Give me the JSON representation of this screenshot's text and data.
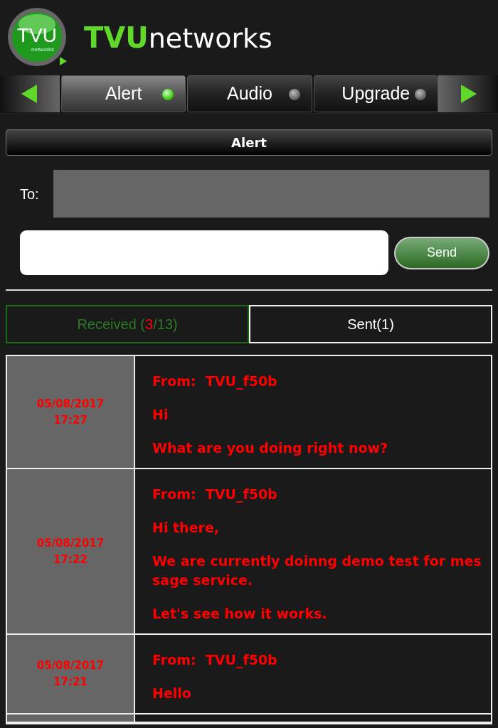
{
  "logo": {
    "badge_text": "TVU",
    "badge_subtext": "networks",
    "brand_bold": "TVU",
    "brand_rest": "networks"
  },
  "tabs": [
    {
      "label": "Alert",
      "selected": true,
      "led_on": true
    },
    {
      "label": "Audio",
      "selected": false,
      "led_on": false
    },
    {
      "label": "Upgrade",
      "selected": false,
      "led_on": false
    }
  ],
  "panel": {
    "title": "Alert"
  },
  "to_label": "To:",
  "send_button": "Send",
  "message_tabs": [
    {
      "selected": true,
      "parts": [
        {
          "text": "Received (",
          "kind": "normal"
        },
        {
          "text": "3",
          "kind": "unread"
        },
        {
          "text": "/13)",
          "kind": "normal"
        }
      ]
    },
    {
      "selected": false,
      "parts": [
        {
          "text": "Sent(1)",
          "kind": "normal"
        }
      ]
    }
  ],
  "messages": [
    {
      "date": "05/08/2017",
      "time": "17:27",
      "from": "From:  TVU_f50b",
      "paragraphs": [
        "Hi",
        "What are you doing right now?"
      ]
    },
    {
      "date": "05/08/2017",
      "time": "17:22",
      "from": "From:  TVU_f50b",
      "paragraphs": [
        "Hi there,",
        "We are currently doinng demo test for message service.",
        "Let's see how it works."
      ]
    },
    {
      "date": "05/08/2017",
      "time": "17:21",
      "from": "From:  TVU_f50b",
      "paragraphs": [
        "Hello"
      ]
    }
  ]
}
